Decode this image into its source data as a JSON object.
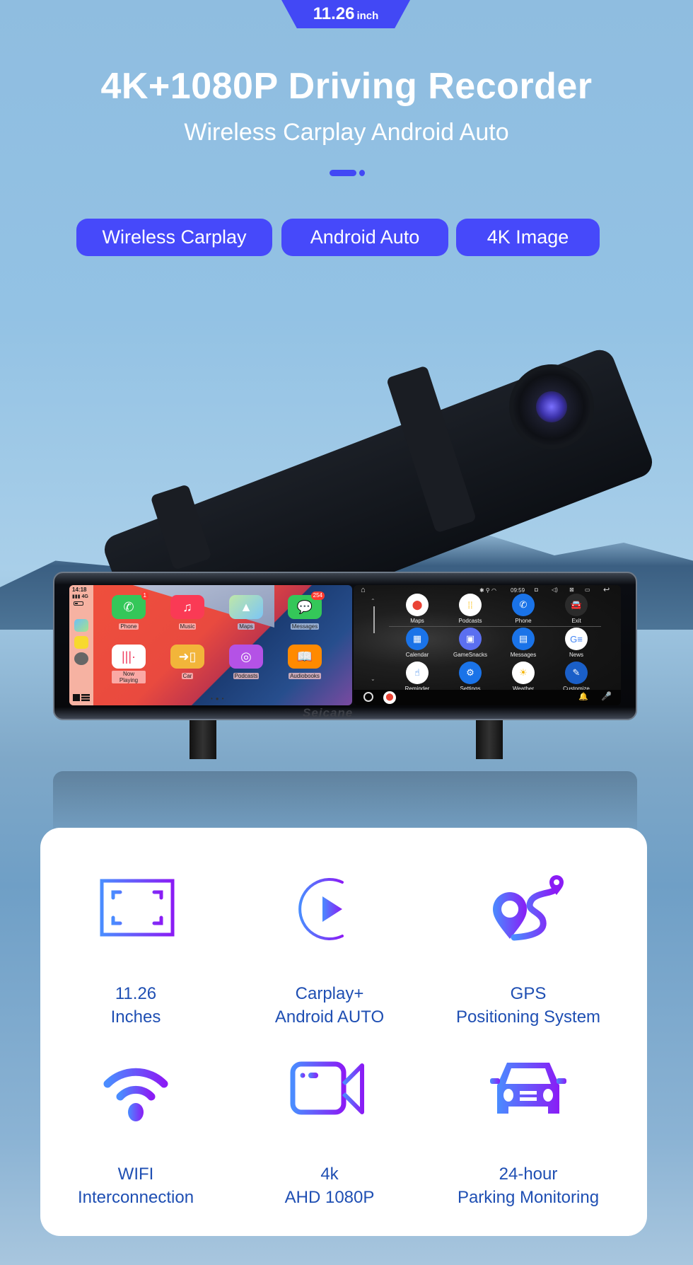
{
  "badge": {
    "size": "11.26",
    "unit": "inch"
  },
  "header": {
    "title": "4K+1080P Driving Recorder",
    "subtitle": "Wireless Carplay Android Auto"
  },
  "tags": [
    "Wireless Carplay",
    "Android Auto",
    "4K Image"
  ],
  "colors": {
    "accent": "#4649fa",
    "label": "#1f4fb3",
    "icon_gradient_start": "#4a8cff",
    "icon_gradient_end": "#8a1cf5"
  },
  "device": {
    "brand": "Seicane",
    "carplay": {
      "time": "14:18",
      "signal": "4G",
      "apps": [
        {
          "label": "Phone",
          "icon": "phone-icon",
          "badge": "1"
        },
        {
          "label": "Music",
          "icon": "music-icon",
          "badge": ""
        },
        {
          "label": "Maps",
          "icon": "maps-icon",
          "badge": ""
        },
        {
          "label": "Messages",
          "icon": "messages-icon",
          "badge": "254"
        },
        {
          "label": "Now Playing",
          "icon": "now-playing-icon",
          "badge": ""
        },
        {
          "label": "Car",
          "icon": "car-icon",
          "badge": ""
        },
        {
          "label": "Podcasts",
          "icon": "podcasts-icon",
          "badge": ""
        },
        {
          "label": "Audiobooks",
          "icon": "audiobooks-icon",
          "badge": ""
        }
      ]
    },
    "android_auto": {
      "time": "09:59",
      "apps": [
        {
          "label": "Maps",
          "icon": "maps-icon"
        },
        {
          "label": "Podcasts",
          "icon": "podcasts-icon"
        },
        {
          "label": "Phone",
          "icon": "phone-icon"
        },
        {
          "label": "Exit",
          "icon": "car-exit-icon"
        },
        {
          "label": "Calendar",
          "icon": "calendar-icon"
        },
        {
          "label": "GameSnacks",
          "icon": "gamesnacks-icon"
        },
        {
          "label": "Messages",
          "icon": "messages-icon"
        },
        {
          "label": "News",
          "icon": "news-icon"
        },
        {
          "label": "Reminder",
          "icon": "reminder-icon"
        },
        {
          "label": "Settings",
          "icon": "settings-icon"
        },
        {
          "label": "Weather",
          "icon": "weather-icon"
        },
        {
          "label": "Customize",
          "icon": "pencil-icon"
        }
      ]
    }
  },
  "features": [
    {
      "line1": "11.26",
      "line2": "Inches",
      "icon": "screen-size-icon"
    },
    {
      "line1": "Carplay+",
      "line2": "Android AUTO",
      "icon": "play-icon"
    },
    {
      "line1": "GPS",
      "line2": "Positioning System",
      "icon": "gps-route-icon"
    },
    {
      "line1": "WIFI",
      "line2": "Interconnection",
      "icon": "wifi-icon"
    },
    {
      "line1": "4k",
      "line2": "AHD 1080P",
      "icon": "video-camera-icon"
    },
    {
      "line1": "24-hour",
      "line2": "Parking Monitoring",
      "icon": "car-icon"
    }
  ]
}
